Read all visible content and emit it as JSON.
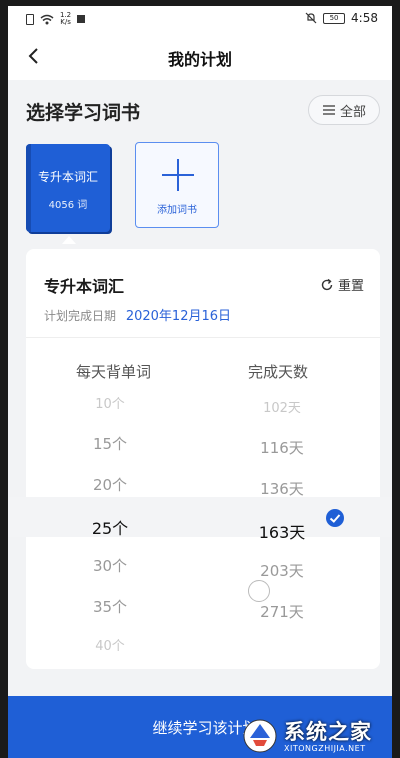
{
  "status_bar": {
    "speed_value": "1.2",
    "speed_unit": "K/s",
    "battery": "50",
    "time": "4:58"
  },
  "header": {
    "title": "我的计划"
  },
  "book_select": {
    "title": "选择学习词书",
    "all_label": "全部",
    "books": [
      {
        "name": "专升本词汇",
        "count": "4056 词"
      }
    ],
    "add_label": "添加词书"
  },
  "plan": {
    "book_name": "专升本词汇",
    "reset_label": "重置",
    "date_label": "计划完成日期",
    "date_value": "2020年12月16日",
    "col_words_header": "每天背单词",
    "col_days_header": "完成天数",
    "words_options": [
      "10个",
      "15个",
      "20个",
      "25个",
      "30个",
      "35个",
      "40个"
    ],
    "days_options": [
      "102天",
      "116天",
      "136天",
      "163天",
      "203天",
      "271天"
    ],
    "selected_words": "25个",
    "selected_days": "163天"
  },
  "footer": {
    "continue_label": "继续学习该计划"
  },
  "watermark": {
    "text": "系统之家",
    "url": "XITONGZHIJIA.NET"
  },
  "colors": {
    "accent": "#1f5fd6",
    "background": "#f2f3f5"
  }
}
